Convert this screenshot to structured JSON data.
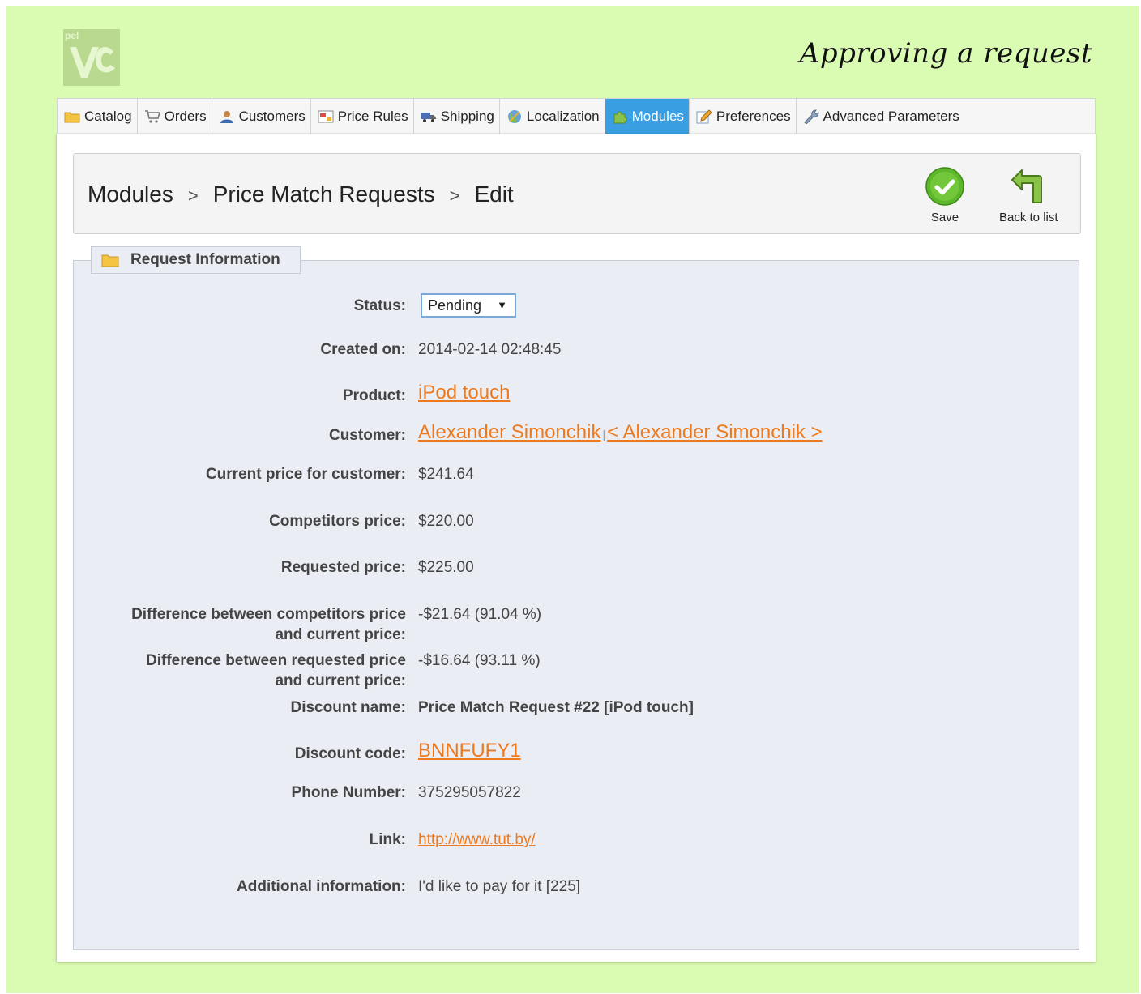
{
  "heading": "Approving a request",
  "logo": {
    "text": "pel",
    "icon": "logo-icon"
  },
  "tabs": [
    {
      "label": "Catalog",
      "icon": "folder-icon",
      "active": false
    },
    {
      "label": "Orders",
      "icon": "cart-icon",
      "active": false
    },
    {
      "label": "Customers",
      "icon": "user-icon",
      "active": false
    },
    {
      "label": "Price Rules",
      "icon": "price-rules-icon",
      "active": false
    },
    {
      "label": "Shipping",
      "icon": "truck-icon",
      "active": false
    },
    {
      "label": "Localization",
      "icon": "globe-icon",
      "active": false
    },
    {
      "label": "Modules",
      "icon": "puzzle-icon",
      "active": true
    },
    {
      "label": "Preferences",
      "icon": "pencil-icon",
      "active": false
    },
    {
      "label": "Advanced Parameters",
      "icon": "wrench-icon",
      "active": false
    }
  ],
  "breadcrumb": [
    "Modules",
    "Price Match Requests",
    "Edit"
  ],
  "breadcrumb_separator": ">",
  "toolbar": {
    "save_label": "Save",
    "back_label": "Back to list"
  },
  "section": {
    "title": "Request Information",
    "icon": "folder-icon"
  },
  "fields": {
    "status": {
      "label": "Status:",
      "value": "Pending"
    },
    "created_on": {
      "label": "Created on:",
      "value": "2014-02-14 02:48:45"
    },
    "product": {
      "label": "Product:",
      "value": "iPod touch"
    },
    "customer": {
      "label": "Customer:",
      "name": "Alexander Simonchik",
      "separator": "|",
      "email_link": "< Alexander Simonchik >"
    },
    "current_price": {
      "label": "Current price for customer:",
      "value": "$241.64"
    },
    "competitors_price": {
      "label": "Competitors price:",
      "value": "$220.00"
    },
    "requested_price": {
      "label": "Requested price:",
      "value": "$225.00"
    },
    "diff_competitors": {
      "label_line1": "Difference between competitors price",
      "label_line2": "and current price:",
      "value": "-$21.64 (91.04 %)"
    },
    "diff_requested": {
      "label_line1": "Difference between requested price",
      "label_line2": "and current price:",
      "value": "-$16.64 (93.11 %)"
    },
    "discount_name": {
      "label": "Discount name:",
      "value": "Price Match Request #22 [iPod touch]"
    },
    "discount_code": {
      "label": "Discount code:",
      "value": "BNNFUFY1"
    },
    "phone": {
      "label": "Phone Number:",
      "value": "375295057822"
    },
    "link": {
      "label": "Link:",
      "value": "http://www.tut.by/"
    },
    "additional_info": {
      "label": "Additional information:",
      "value": "I'd like to pay for it [225]"
    }
  },
  "colors": {
    "page_background": "#dafbb2",
    "active_tab": "#3a9ee2",
    "link": "#ee7a1d",
    "save_green": "#5cb82a"
  }
}
